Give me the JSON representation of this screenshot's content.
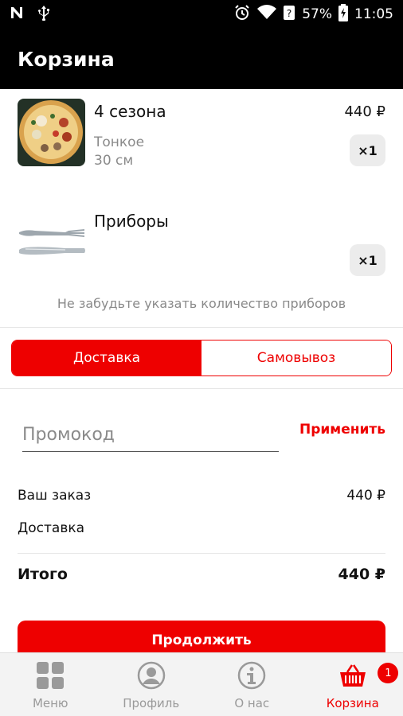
{
  "status": {
    "battery": "57%",
    "time": "11:05"
  },
  "header": {
    "title": "Корзина"
  },
  "cart": {
    "items": [
      {
        "name": "4 сезона",
        "price": "440 ₽",
        "details": [
          "Тонкое",
          "30 см"
        ],
        "qty": "×1"
      },
      {
        "name": "Приборы",
        "qty": "×1"
      }
    ],
    "hint": "Не забудьте указать количество приборов"
  },
  "delivery": {
    "options": [
      "Доставка",
      "Самовывоз"
    ],
    "selected": "Доставка"
  },
  "promo": {
    "placeholder": "Промокод",
    "value": "",
    "apply_label": "Применить"
  },
  "summary": {
    "order_label": "Ваш заказ",
    "order_value": "440 ₽",
    "delivery_label": "Доставка",
    "total_label": "Итого",
    "total_value": "440 ₽"
  },
  "continue_label": "Продолжить",
  "nav": {
    "items": [
      {
        "label": "Меню",
        "icon": "grid-icon"
      },
      {
        "label": "Профиль",
        "icon": "profile-icon"
      },
      {
        "label": "О нас",
        "icon": "info-icon"
      },
      {
        "label": "Корзина",
        "icon": "basket-icon",
        "badge": "1",
        "active": true
      }
    ]
  },
  "colors": {
    "accent": "#ee0000",
    "bar": "#000000"
  }
}
